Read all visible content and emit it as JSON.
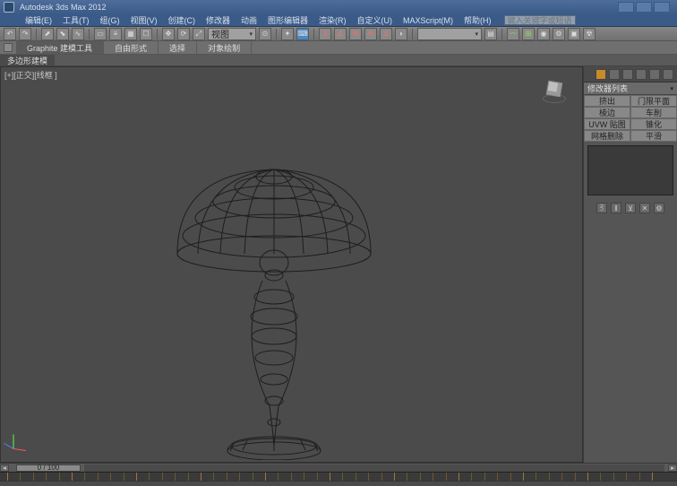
{
  "title": "Autodesk 3ds Max 2012",
  "menu": [
    "编辑(E)",
    "工具(T)",
    "组(G)",
    "视图(V)",
    "创建(C)",
    "修改器",
    "动画",
    "图形编辑器",
    "渲染(R)",
    "自定义(U)",
    "MAXScript(M)",
    "帮助(H)"
  ],
  "menu_search_placeholder": "键入关键字或短语",
  "toolbar_view_drop": "视图",
  "ribbon": {
    "lead": "Graphite 建模工具",
    "tabs": [
      "自由形式",
      "选择",
      "对象绘制"
    ]
  },
  "subribbon": "多边形建模",
  "viewport_label": "[+][正交][线框 ]",
  "time_slider": "0 / 100",
  "panel": {
    "list_label": "修改器列表",
    "buttons": [
      [
        "挤出",
        "门限平面"
      ],
      [
        "棱边",
        "车削"
      ],
      [
        "UVW 贴图",
        "锥化"
      ],
      [
        "网格删除",
        "平滑"
      ]
    ]
  }
}
